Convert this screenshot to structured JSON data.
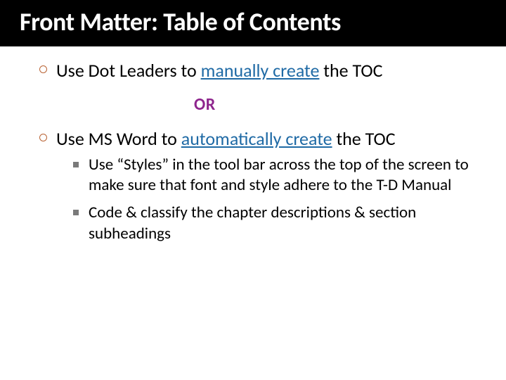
{
  "title": "Front Matter: Table of Contents",
  "b1": {
    "pre": "Use Dot Leaders to ",
    "link": "manually create",
    "post": " the TOC"
  },
  "or_label": "OR",
  "b2": {
    "pre": "Use MS Word to ",
    "link": "automatically create",
    "post": " the TOC"
  },
  "sub": {
    "s1": "Use “Styles” in the tool bar across the top of the screen to make sure that font and style adhere to the T-D Manual",
    "s2": "Code & classify the chapter descriptions & section subheadings"
  }
}
